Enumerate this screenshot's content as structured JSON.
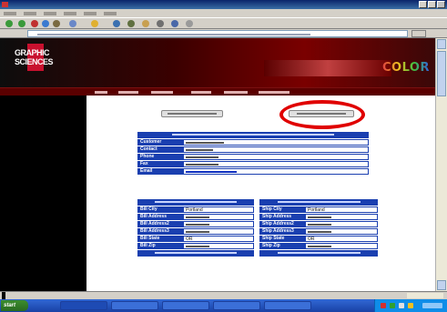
{
  "header": {
    "brand_color_word": "COLOR"
  },
  "customer_table": {
    "rows": [
      {
        "label": "Customer",
        "value_width": 42,
        "link": false
      },
      {
        "label": "Contact",
        "value_width": 30,
        "link": false
      },
      {
        "label": "Phone",
        "value_width": 36,
        "link": false
      },
      {
        "label": "Fax",
        "value_width": 36,
        "link": false
      },
      {
        "label": "Email",
        "value_width": 56,
        "link": true
      }
    ]
  },
  "billing_table": {
    "rows": [
      {
        "label": "Bill City",
        "value": "Portland"
      },
      {
        "label": "Bill Address",
        "value": ""
      },
      {
        "label": "Bill Address2",
        "value": ""
      },
      {
        "label": "Bill Address3",
        "value": ""
      },
      {
        "label": "Bill State",
        "value": "OR"
      },
      {
        "label": "Bill Zip",
        "value": ""
      }
    ]
  },
  "shipping_table": {
    "rows": [
      {
        "label": "Ship City",
        "value": "Portland"
      },
      {
        "label": "Ship Address",
        "value": ""
      },
      {
        "label": "Ship Address2",
        "value": ""
      },
      {
        "label": "Ship Address3",
        "value": ""
      },
      {
        "label": "Ship State",
        "value": "OR"
      },
      {
        "label": "Ship Zip",
        "value": ""
      }
    ]
  },
  "taskbar": {
    "start_label": "start"
  },
  "colors": {
    "table_blue": "#1a3fb0",
    "highlight_ring": "#e00000"
  }
}
